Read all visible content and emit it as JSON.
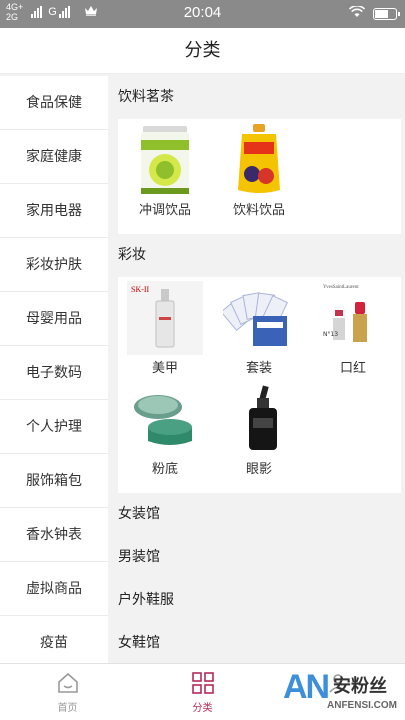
{
  "statusbar": {
    "network_top": "4G+",
    "network_bottom": "2G",
    "carrier2": "G",
    "time": "20:04"
  },
  "header": {
    "title": "分类"
  },
  "sidebar": {
    "items": [
      {
        "label": "食品保健"
      },
      {
        "label": "家庭健康"
      },
      {
        "label": "家用电器"
      },
      {
        "label": "彩妆护肤"
      },
      {
        "label": "母婴用品"
      },
      {
        "label": "电子数码"
      },
      {
        "label": "个人护理"
      },
      {
        "label": "服饰箱包"
      },
      {
        "label": "香水钟表"
      },
      {
        "label": "虚拟商品"
      },
      {
        "label": "疫苗"
      }
    ]
  },
  "sections": {
    "drinks": {
      "title": "饮料茗茶",
      "items": [
        {
          "label": "冲调饮品",
          "icon": "formula-can-icon"
        },
        {
          "label": "饮料饮品",
          "icon": "juice-pouch-icon"
        }
      ]
    },
    "makeup": {
      "title": "彩妆",
      "items": [
        {
          "label": "美甲",
          "icon": "skii-bottle-icon"
        },
        {
          "label": "套装",
          "icon": "face-mask-set-icon"
        },
        {
          "label": "口红",
          "icon": "lipstick-icon"
        },
        {
          "label": "粉底",
          "icon": "foundation-jar-icon"
        },
        {
          "label": "眼影",
          "icon": "serum-bottle-icon"
        }
      ],
      "brand_text_1": "SK-II",
      "brand_text_2": "YvesSaintLaurent",
      "brand_text_3": "N°13"
    },
    "collapsed": [
      {
        "title": "女装馆"
      },
      {
        "title": "男装馆"
      },
      {
        "title": "户外鞋服"
      },
      {
        "title": "女鞋馆"
      }
    ]
  },
  "tabbar": {
    "items": [
      {
        "label": "首页",
        "icon": "home-icon"
      },
      {
        "label": "分类",
        "icon": "category-grid-icon"
      },
      {
        "label": "",
        "icon": "user-icon"
      }
    ]
  },
  "watermark": {
    "brand": "AN",
    "text": "安粉丝",
    "url": "ANFENSI.COM"
  },
  "colors": {
    "accent": "#b62a5a",
    "statusbar": "#8a8a8a",
    "background": "#f2f2f2"
  }
}
